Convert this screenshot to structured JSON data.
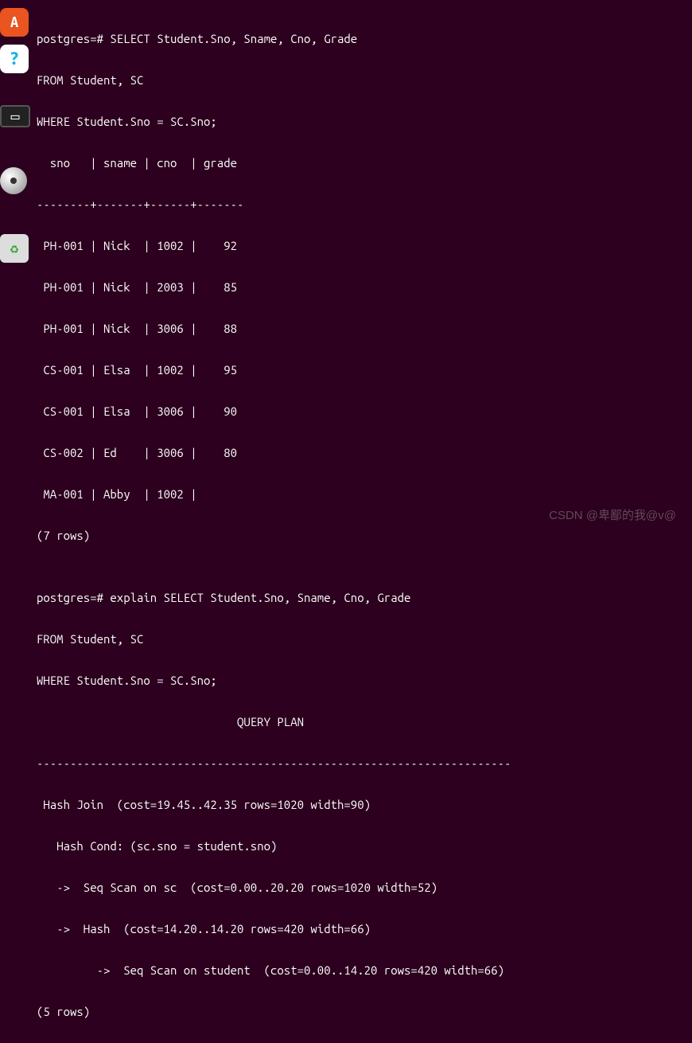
{
  "launcher": {
    "items": [
      {
        "name": "ubuntu-software",
        "glyph": "A"
      },
      {
        "name": "help",
        "glyph": "?"
      },
      {
        "name": "workspace",
        "glyph": "▭"
      },
      {
        "name": "disc",
        "glyph": ""
      },
      {
        "name": "trash",
        "glyph": "♻"
      }
    ]
  },
  "terminal": {
    "lines": [
      "postgres=# SELECT Student.Sno, Sname, Cno, Grade",
      "FROM Student, SC",
      "WHERE Student.Sno = SC.Sno;",
      "  sno   | sname | cno  | grade ",
      "--------+-------+------+-------",
      " PH-001 | Nick  | 1002 |    92",
      " PH-001 | Nick  | 2003 |    85",
      " PH-001 | Nick  | 3006 |    88",
      " CS-001 | Elsa  | 1002 |    95",
      " CS-001 | Elsa  | 3006 |    90",
      " CS-002 | Ed    | 3006 |    80",
      " MA-001 | Abby  | 1002 |      ",
      "(7 rows)",
      "",
      "postgres=# explain SELECT Student.Sno, Sname, Cno, Grade",
      "FROM Student, SC",
      "WHERE Student.Sno = SC.Sno;",
      "                              QUERY PLAN                               ",
      "-----------------------------------------------------------------------",
      " Hash Join  (cost=19.45..42.35 rows=1020 width=90)",
      "   Hash Cond: (sc.sno = student.sno)",
      "   ->  Seq Scan on sc  (cost=0.00..20.20 rows=1020 width=52)",
      "   ->  Hash  (cost=14.20..14.20 rows=420 width=66)",
      "         ->  Seq Scan on student  (cost=0.00..14.20 rows=420 width=66)",
      "(5 rows)"
    ]
  },
  "watermark": "CSDN @卑鄙的我@v@"
}
